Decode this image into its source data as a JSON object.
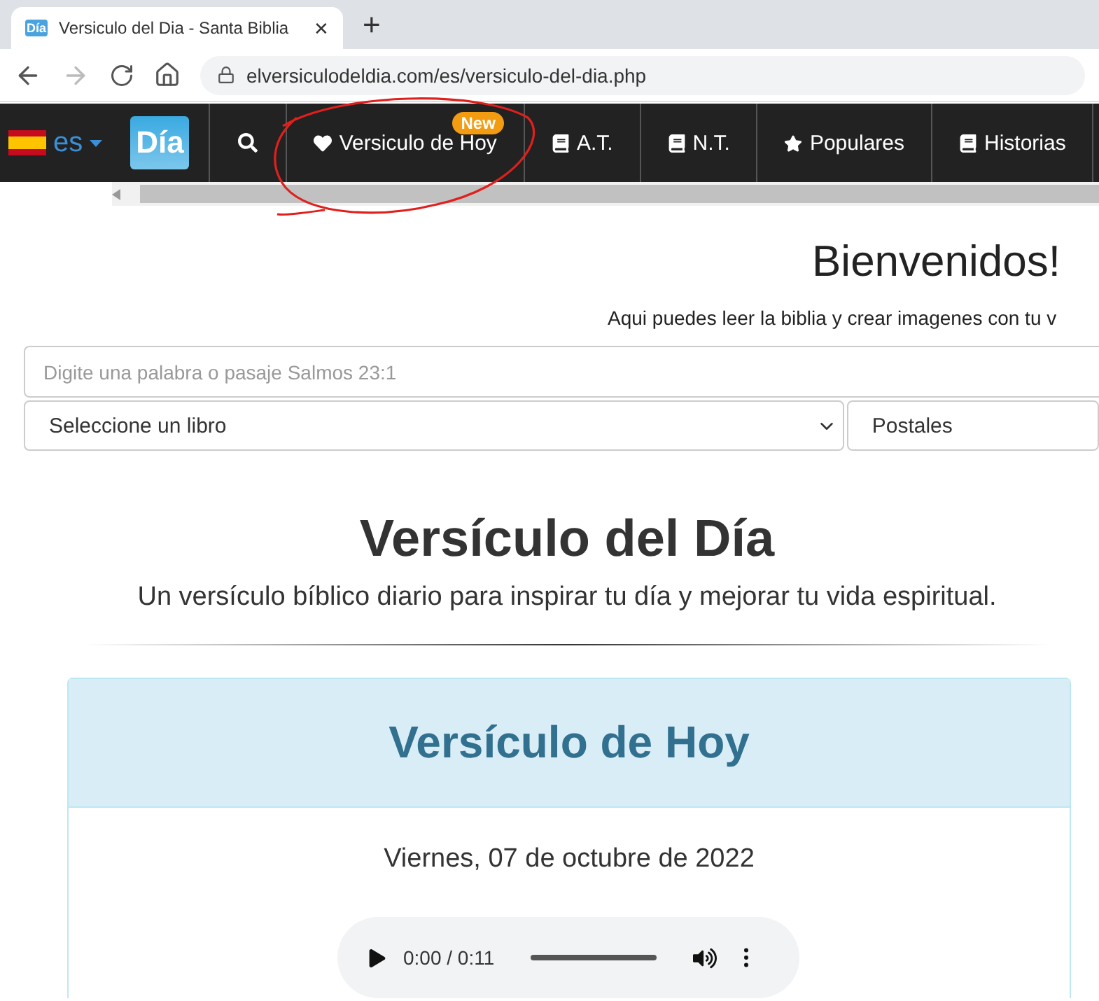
{
  "browser": {
    "tabs": [
      {
        "favicon": "Día",
        "title": "Versiculo del Dia - Santa Biblia",
        "selected": true
      }
    ],
    "close_glyph": "✕",
    "new_tab_glyph": "+",
    "url": "elversiculodeldia.com/es/versiculo-del-dia.php"
  },
  "navbar": {
    "language": "es",
    "logo": "Día",
    "items": [
      {
        "kind": "search"
      },
      {
        "kind": "heart",
        "label": "Versiculo de Hoy",
        "badge": "New"
      },
      {
        "kind": "book",
        "label": "A.T."
      },
      {
        "kind": "book",
        "label": "N.T."
      },
      {
        "kind": "star",
        "label": "Populares"
      },
      {
        "kind": "book",
        "label": "Historias"
      }
    ]
  },
  "annotation": {
    "kind": "circle",
    "color": "#e0201c"
  },
  "welcome": {
    "title": "Bienvenidos!",
    "subtitle": "Aqui puedes leer la biblia y crear imagenes con tu v"
  },
  "search": {
    "placeholder": "Digite una palabra o pasaje Salmos 23:1"
  },
  "book_select": {
    "value": "Seleccione un libro"
  },
  "category_select": {
    "value": "Postales"
  },
  "heading": "Versículo del Día",
  "tagline": "Un versículo bíblico diario para inspirar tu día y mejorar tu vida espiritual.",
  "card": {
    "title": "Versículo de Hoy",
    "date": "Viernes, 07 de octubre de 2022",
    "audio": {
      "time": "0:00 / 0:11"
    }
  }
}
